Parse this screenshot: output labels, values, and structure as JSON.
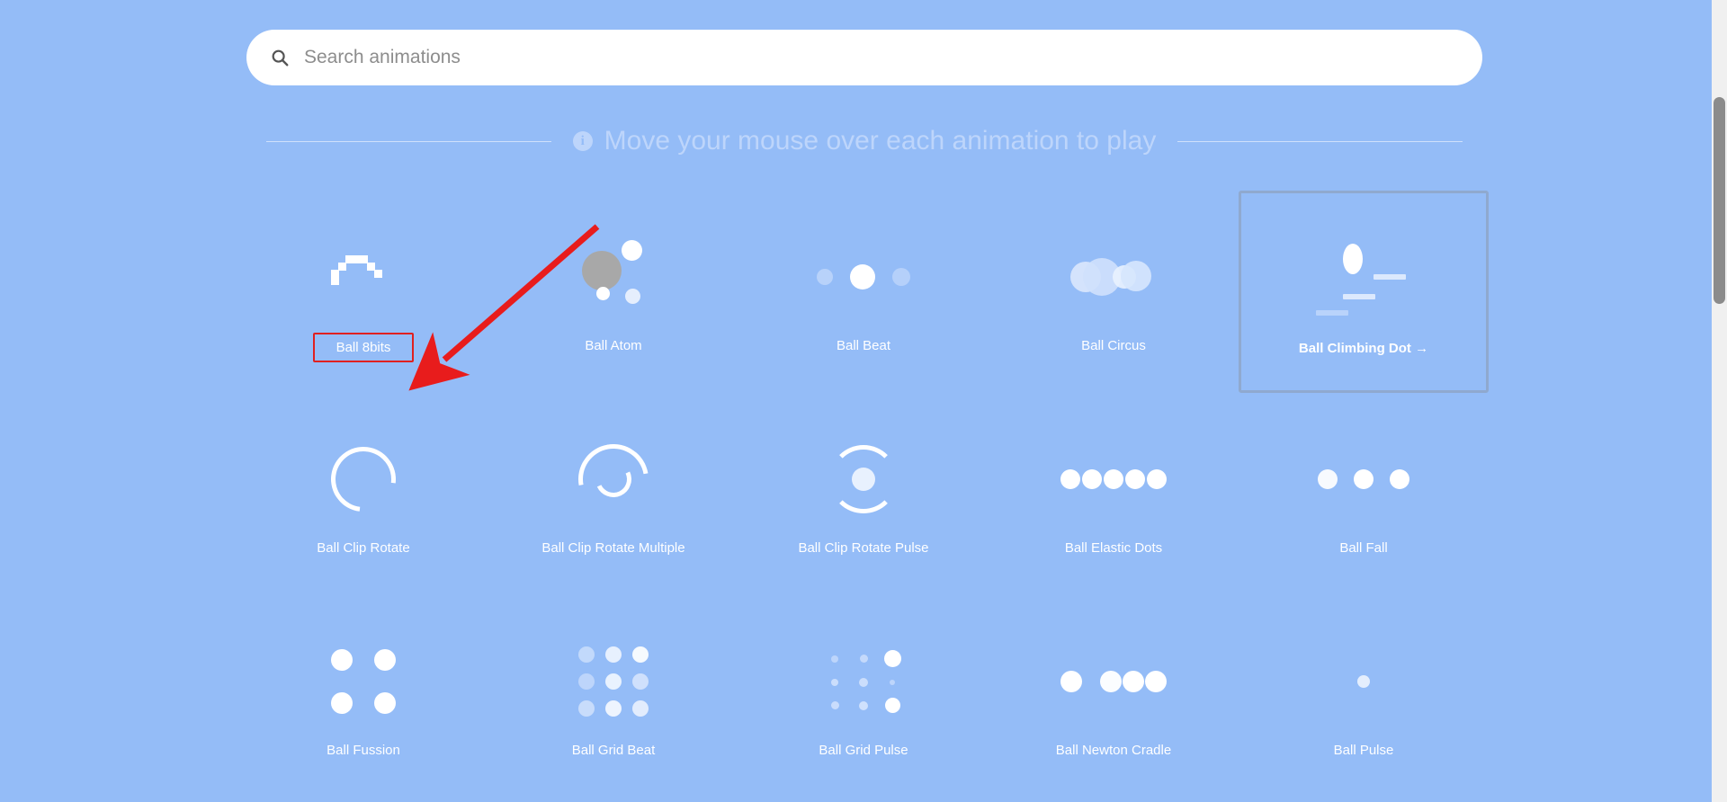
{
  "page": {
    "background_color": "#94bcf7",
    "accent_color": "#ffffff",
    "highlight_box_color": "#e02020",
    "selected_card_border_color": "#8fa9cf"
  },
  "search": {
    "placeholder": "Search animations",
    "value": "",
    "icon": "search-icon"
  },
  "hint": {
    "icon": "info-icon",
    "icon_glyph": "i",
    "text": "Move your mouse over each animation to play"
  },
  "grid": {
    "columns": 5,
    "items": [
      {
        "label": "Ball 8bits",
        "kind": "pixel8",
        "selected": false,
        "annotated": true
      },
      {
        "label": "Ball Atom",
        "kind": "atom",
        "selected": false,
        "annotated": false
      },
      {
        "label": "Ball Beat",
        "kind": "beat",
        "selected": false,
        "annotated": false
      },
      {
        "label": "Ball Circus",
        "kind": "circus",
        "selected": false,
        "annotated": false
      },
      {
        "label": "Ball Climbing Dot →",
        "kind": "climb",
        "selected": true,
        "annotated": false
      },
      {
        "label": "Ball Clip Rotate",
        "kind": "ring",
        "selected": false,
        "annotated": false
      },
      {
        "label": "Ball Clip Rotate Multiple",
        "kind": "ringmulti",
        "selected": false,
        "annotated": false
      },
      {
        "label": "Ball Clip Rotate Pulse",
        "kind": "pulsering",
        "selected": false,
        "annotated": false
      },
      {
        "label": "Ball Elastic Dots",
        "kind": "elastic",
        "selected": false,
        "annotated": false
      },
      {
        "label": "Ball Fall",
        "kind": "fall",
        "selected": false,
        "annotated": false
      },
      {
        "label": "Ball Fussion",
        "kind": "fussion",
        "selected": false,
        "annotated": false
      },
      {
        "label": "Ball Grid Beat",
        "kind": "gridbeat",
        "selected": false,
        "annotated": false
      },
      {
        "label": "Ball Grid Pulse",
        "kind": "gridpulse",
        "selected": false,
        "annotated": false
      },
      {
        "label": "Ball Newton Cradle",
        "kind": "cradle",
        "selected": false,
        "annotated": false
      },
      {
        "label": "Ball Pulse",
        "kind": "pulse",
        "selected": false,
        "annotated": false
      }
    ]
  },
  "annotation": {
    "arrow_color": "#e02020",
    "target_label": "Ball 8bits"
  },
  "scrollbar": {
    "visible": true,
    "thumb_color": "#8b8b8b"
  }
}
